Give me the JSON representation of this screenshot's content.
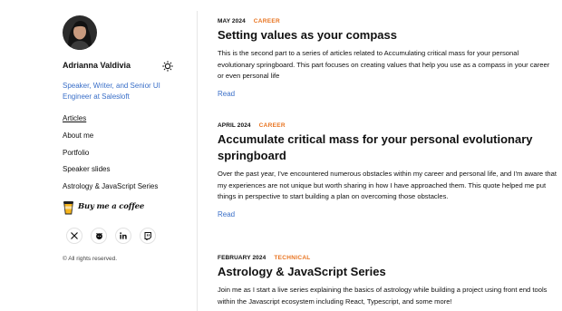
{
  "profile": {
    "name": "Adrianna Valdivia",
    "role": "Speaker, Writer, and Senior UI Engineer at Salesloft",
    "avatar_icon": "person-avatar"
  },
  "nav": {
    "items": [
      {
        "label": "Articles",
        "active": true
      },
      {
        "label": "About me"
      },
      {
        "label": "Portfolio"
      },
      {
        "label": "Speaker slides"
      },
      {
        "label": "Astrology & JavaScript Series"
      }
    ]
  },
  "coffee": {
    "label": "Buy me a coffee",
    "icon": "coffee-cup-icon"
  },
  "social": [
    {
      "name": "x-icon"
    },
    {
      "name": "github-icon"
    },
    {
      "name": "linkedin-icon"
    },
    {
      "name": "twitch-icon"
    }
  ],
  "footer": {
    "copyright": "© All rights reserved."
  },
  "posts": [
    {
      "date": "MAY 2024",
      "category": "CAREER",
      "title": "Setting values as your compass",
      "excerpt": "This is the second part to a series of articles related to Accumulating critical mass for your personal evolutionary springboard. This part focuses on creating values that help you use as a compass in your career or even personal life",
      "read": "Read"
    },
    {
      "date": "APRIL 2024",
      "category": "CAREER",
      "title": "Accumulate critical mass for your personal evolutionary springboard",
      "excerpt": "Over the past year, I've encountered numerous obstacles within my career and personal life, and I'm aware that my experiences are not unique but worth sharing in how I have approached them. This quote helped me put things in perspective to start building a plan on overcoming those obstacles.",
      "read": "Read"
    },
    {
      "date": "FEBRUARY 2024",
      "category": "TECHNICAL",
      "title": "Astrology & JavaScript Series",
      "excerpt": "Join me as I start a live series explaining the basics of astrology while building a project using front end tools within the Javascript ecosystem including React, Typescript, and some more!"
    }
  ],
  "colors": {
    "accent": "#3a6fc8",
    "category": "#e8731f"
  }
}
